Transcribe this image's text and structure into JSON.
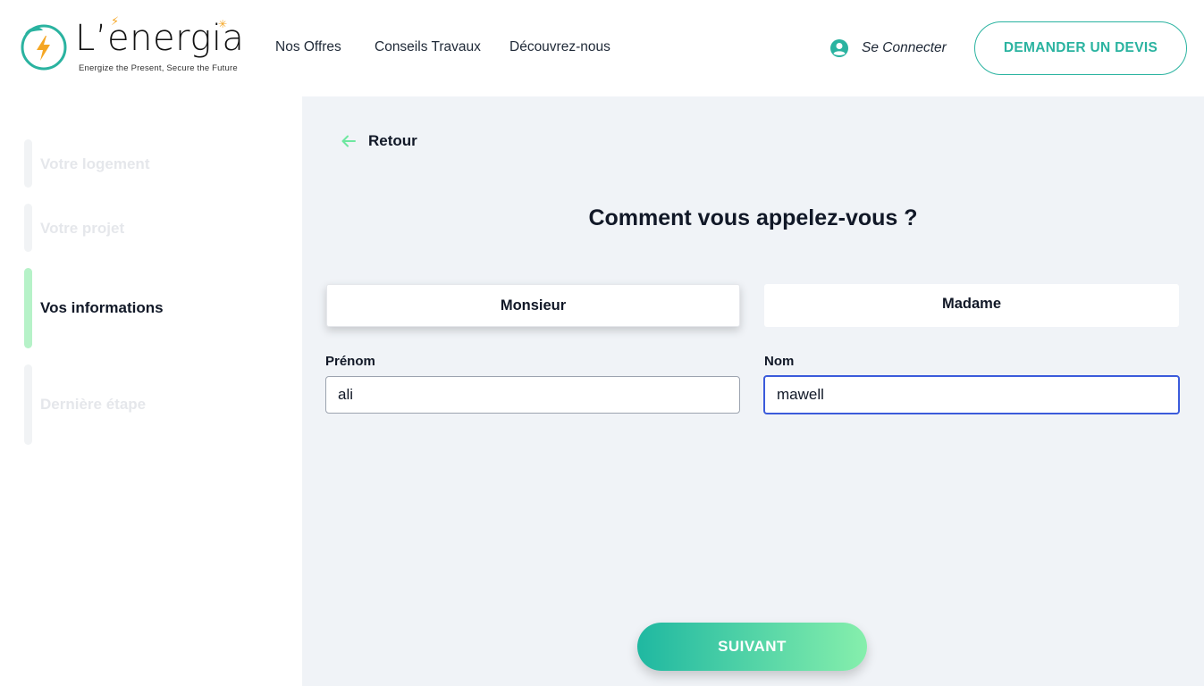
{
  "brand": {
    "name": "L’energia",
    "tagline": "Energize the Present, Secure the Future",
    "accent_color": "#2ab3a0",
    "sun_color": "#f5a623"
  },
  "nav": {
    "items": [
      {
        "label": "Nos Offres"
      },
      {
        "label": "Conseils Travaux"
      },
      {
        "label": "Découvrez-nous"
      }
    ],
    "connect_label": "Se Connecter",
    "devis_label": "DEMANDER UN DEVIS"
  },
  "sidebar": {
    "steps": [
      {
        "label": "Votre logement",
        "active": false
      },
      {
        "label": "Votre projet",
        "active": false
      },
      {
        "label": "Vos informations",
        "active": true
      },
      {
        "label": "Dernière étape",
        "active": false
      }
    ]
  },
  "main": {
    "back_label": "Retour",
    "question": "Comment vous appelez-vous ?",
    "civility": {
      "options": [
        "Monsieur",
        "Madame"
      ],
      "selected": "Monsieur"
    },
    "fields": {
      "first_name": {
        "label": "Prénom",
        "value": "ali"
      },
      "last_name": {
        "label": "Nom",
        "value": "mawell"
      }
    },
    "next_label": "SUIVANT"
  }
}
